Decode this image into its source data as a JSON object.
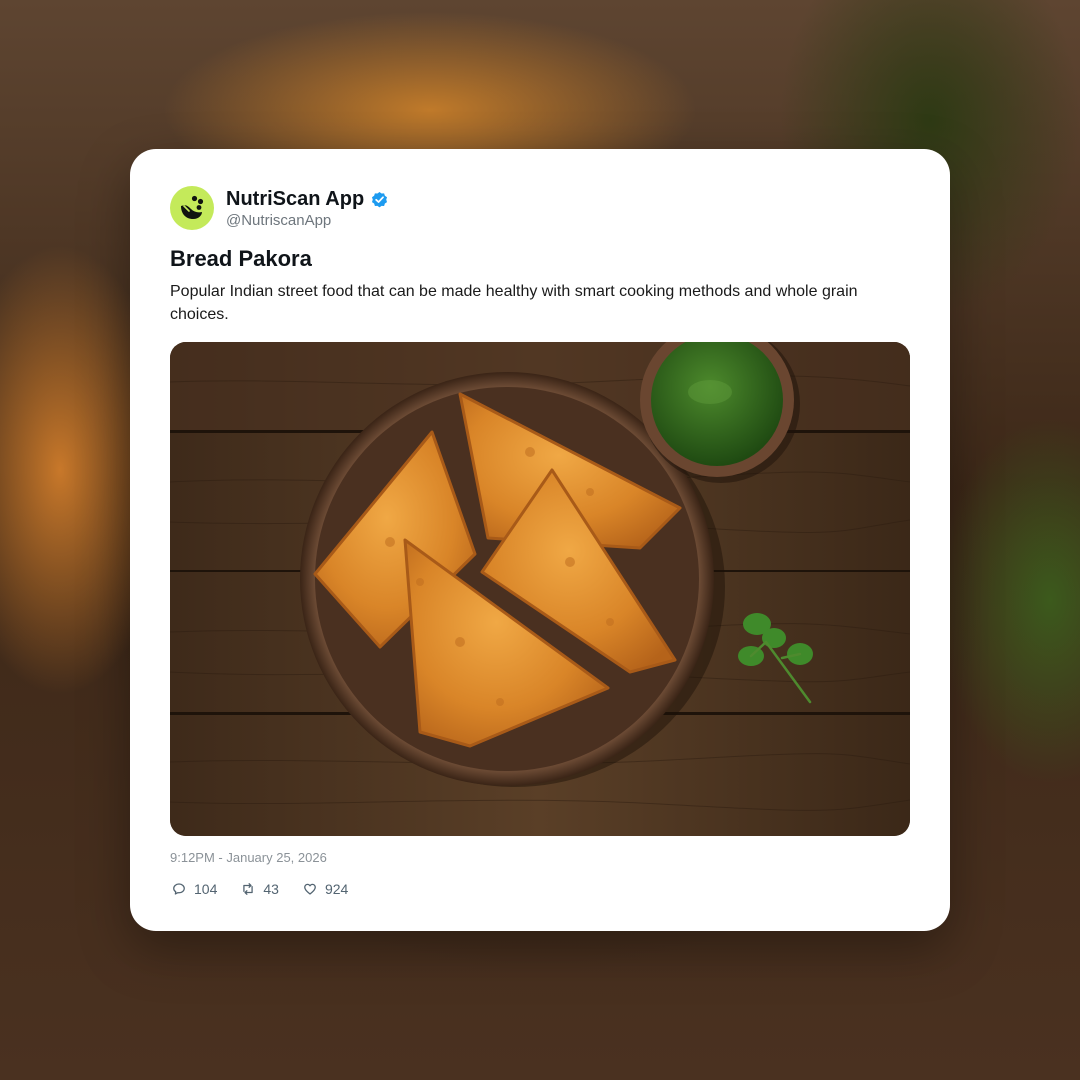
{
  "post": {
    "display_name": "NutriScan App",
    "handle": "@NutriscanApp",
    "verified": true,
    "title": "Bread Pakora",
    "body": "Popular Indian street food that can be made healthy with smart cooking methods and whole grain choices.",
    "timestamp": "9:12PM - January 25, 2026",
    "image": {
      "subject": "bread pakora on brown plate with green chutney and cilantro on wooden table"
    }
  },
  "stats": {
    "replies": "104",
    "retweets": "43",
    "likes": "924"
  },
  "icons": {
    "avatar": "nutriscan-logo-icon",
    "verified": "verified-badge-icon",
    "reply": "reply-icon",
    "retweet": "retweet-icon",
    "like": "heart-icon"
  },
  "colors": {
    "avatar_bg": "#c4ea5a",
    "verified_blue": "#1d9bf0",
    "card_bg": "#ffffff",
    "muted_text": "#6e767d"
  }
}
